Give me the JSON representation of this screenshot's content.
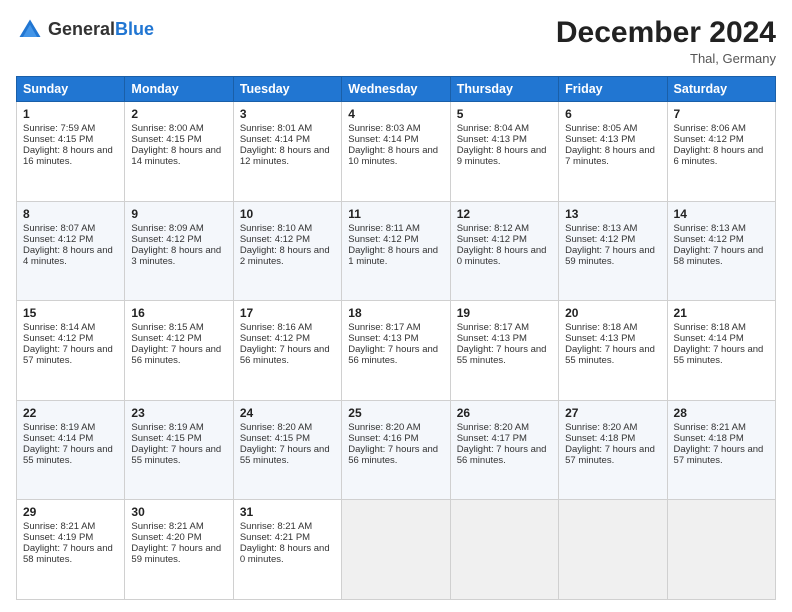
{
  "header": {
    "logo_general": "General",
    "logo_blue": "Blue",
    "month_title": "December 2024",
    "subtitle": "Thal, Germany"
  },
  "days_of_week": [
    "Sunday",
    "Monday",
    "Tuesday",
    "Wednesday",
    "Thursday",
    "Friday",
    "Saturday"
  ],
  "weeks": [
    [
      {
        "day": "1",
        "sunrise": "Sunrise: 7:59 AM",
        "sunset": "Sunset: 4:15 PM",
        "daylight": "Daylight: 8 hours and 16 minutes."
      },
      {
        "day": "2",
        "sunrise": "Sunrise: 8:00 AM",
        "sunset": "Sunset: 4:15 PM",
        "daylight": "Daylight: 8 hours and 14 minutes."
      },
      {
        "day": "3",
        "sunrise": "Sunrise: 8:01 AM",
        "sunset": "Sunset: 4:14 PM",
        "daylight": "Daylight: 8 hours and 12 minutes."
      },
      {
        "day": "4",
        "sunrise": "Sunrise: 8:03 AM",
        "sunset": "Sunset: 4:14 PM",
        "daylight": "Daylight: 8 hours and 10 minutes."
      },
      {
        "day": "5",
        "sunrise": "Sunrise: 8:04 AM",
        "sunset": "Sunset: 4:13 PM",
        "daylight": "Daylight: 8 hours and 9 minutes."
      },
      {
        "day": "6",
        "sunrise": "Sunrise: 8:05 AM",
        "sunset": "Sunset: 4:13 PM",
        "daylight": "Daylight: 8 hours and 7 minutes."
      },
      {
        "day": "7",
        "sunrise": "Sunrise: 8:06 AM",
        "sunset": "Sunset: 4:12 PM",
        "daylight": "Daylight: 8 hours and 6 minutes."
      }
    ],
    [
      {
        "day": "8",
        "sunrise": "Sunrise: 8:07 AM",
        "sunset": "Sunset: 4:12 PM",
        "daylight": "Daylight: 8 hours and 4 minutes."
      },
      {
        "day": "9",
        "sunrise": "Sunrise: 8:09 AM",
        "sunset": "Sunset: 4:12 PM",
        "daylight": "Daylight: 8 hours and 3 minutes."
      },
      {
        "day": "10",
        "sunrise": "Sunrise: 8:10 AM",
        "sunset": "Sunset: 4:12 PM",
        "daylight": "Daylight: 8 hours and 2 minutes."
      },
      {
        "day": "11",
        "sunrise": "Sunrise: 8:11 AM",
        "sunset": "Sunset: 4:12 PM",
        "daylight": "Daylight: 8 hours and 1 minute."
      },
      {
        "day": "12",
        "sunrise": "Sunrise: 8:12 AM",
        "sunset": "Sunset: 4:12 PM",
        "daylight": "Daylight: 8 hours and 0 minutes."
      },
      {
        "day": "13",
        "sunrise": "Sunrise: 8:13 AM",
        "sunset": "Sunset: 4:12 PM",
        "daylight": "Daylight: 7 hours and 59 minutes."
      },
      {
        "day": "14",
        "sunrise": "Sunrise: 8:13 AM",
        "sunset": "Sunset: 4:12 PM",
        "daylight": "Daylight: 7 hours and 58 minutes."
      }
    ],
    [
      {
        "day": "15",
        "sunrise": "Sunrise: 8:14 AM",
        "sunset": "Sunset: 4:12 PM",
        "daylight": "Daylight: 7 hours and 57 minutes."
      },
      {
        "day": "16",
        "sunrise": "Sunrise: 8:15 AM",
        "sunset": "Sunset: 4:12 PM",
        "daylight": "Daylight: 7 hours and 56 minutes."
      },
      {
        "day": "17",
        "sunrise": "Sunrise: 8:16 AM",
        "sunset": "Sunset: 4:12 PM",
        "daylight": "Daylight: 7 hours and 56 minutes."
      },
      {
        "day": "18",
        "sunrise": "Sunrise: 8:17 AM",
        "sunset": "Sunset: 4:13 PM",
        "daylight": "Daylight: 7 hours and 56 minutes."
      },
      {
        "day": "19",
        "sunrise": "Sunrise: 8:17 AM",
        "sunset": "Sunset: 4:13 PM",
        "daylight": "Daylight: 7 hours and 55 minutes."
      },
      {
        "day": "20",
        "sunrise": "Sunrise: 8:18 AM",
        "sunset": "Sunset: 4:13 PM",
        "daylight": "Daylight: 7 hours and 55 minutes."
      },
      {
        "day": "21",
        "sunrise": "Sunrise: 8:18 AM",
        "sunset": "Sunset: 4:14 PM",
        "daylight": "Daylight: 7 hours and 55 minutes."
      }
    ],
    [
      {
        "day": "22",
        "sunrise": "Sunrise: 8:19 AM",
        "sunset": "Sunset: 4:14 PM",
        "daylight": "Daylight: 7 hours and 55 minutes."
      },
      {
        "day": "23",
        "sunrise": "Sunrise: 8:19 AM",
        "sunset": "Sunset: 4:15 PM",
        "daylight": "Daylight: 7 hours and 55 minutes."
      },
      {
        "day": "24",
        "sunrise": "Sunrise: 8:20 AM",
        "sunset": "Sunset: 4:15 PM",
        "daylight": "Daylight: 7 hours and 55 minutes."
      },
      {
        "day": "25",
        "sunrise": "Sunrise: 8:20 AM",
        "sunset": "Sunset: 4:16 PM",
        "daylight": "Daylight: 7 hours and 56 minutes."
      },
      {
        "day": "26",
        "sunrise": "Sunrise: 8:20 AM",
        "sunset": "Sunset: 4:17 PM",
        "daylight": "Daylight: 7 hours and 56 minutes."
      },
      {
        "day": "27",
        "sunrise": "Sunrise: 8:20 AM",
        "sunset": "Sunset: 4:18 PM",
        "daylight": "Daylight: 7 hours and 57 minutes."
      },
      {
        "day": "28",
        "sunrise": "Sunrise: 8:21 AM",
        "sunset": "Sunset: 4:18 PM",
        "daylight": "Daylight: 7 hours and 57 minutes."
      }
    ],
    [
      {
        "day": "29",
        "sunrise": "Sunrise: 8:21 AM",
        "sunset": "Sunset: 4:19 PM",
        "daylight": "Daylight: 7 hours and 58 minutes."
      },
      {
        "day": "30",
        "sunrise": "Sunrise: 8:21 AM",
        "sunset": "Sunset: 4:20 PM",
        "daylight": "Daylight: 7 hours and 59 minutes."
      },
      {
        "day": "31",
        "sunrise": "Sunrise: 8:21 AM",
        "sunset": "Sunset: 4:21 PM",
        "daylight": "Daylight: 8 hours and 0 minutes."
      },
      null,
      null,
      null,
      null
    ]
  ]
}
